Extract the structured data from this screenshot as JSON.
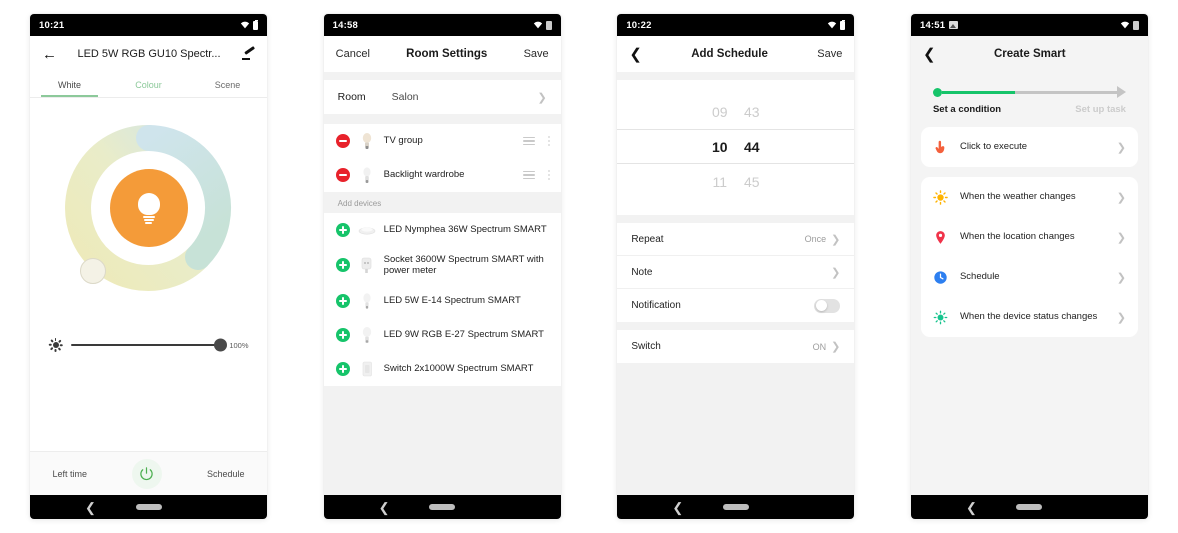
{
  "phone1": {
    "status": {
      "time": "10:21",
      "wifi": "wifi-icon",
      "battery": "battery-icon"
    },
    "appbar": {
      "back": "back-arrow-icon",
      "title": "LED 5W RGB GU10 Spectr...",
      "edit": "pencil-icon"
    },
    "tabs": [
      {
        "label": "White",
        "state": "active"
      },
      {
        "label": "Colour",
        "state": "green"
      },
      {
        "label": "Scene",
        "state": "normal"
      }
    ],
    "wheel": {
      "center_color": "#f49b39",
      "warm_color": "#eee7b5",
      "cool_color": "#cfe6ec",
      "mint_color": "#c9e3d8",
      "bulb_icon": "bulb-icon",
      "knob": "color-temperature-knob"
    },
    "slider": {
      "icon": "brightness-icon",
      "value_label": "100%"
    },
    "footer": {
      "left": "Left time",
      "power_icon": "power-icon",
      "right": "Schedule"
    },
    "nav": {
      "back": "nav-back-icon",
      "pill": "nav-home-pill"
    }
  },
  "phone2": {
    "status": {
      "time": "14:58"
    },
    "appbar": {
      "cancel": "Cancel",
      "title": "Room Settings",
      "save": "Save"
    },
    "room": {
      "key": "Room",
      "value": "Salon",
      "chevron": "chevron-right-icon"
    },
    "assigned": [
      {
        "name": "TV group",
        "action": "remove",
        "thumb": "light-device-thumb",
        "handle": "drag-handle-icon"
      },
      {
        "name": "Backlight wardrobe",
        "action": "remove",
        "thumb": "light-device-thumb",
        "handle": "drag-handle-icon"
      }
    ],
    "add_label": "Add devices",
    "available": [
      {
        "name": "LED Nymphea 36W Spectrum SMART",
        "thumb": "ceiling-lamp-thumb"
      },
      {
        "name": "Socket 3600W Spectrum SMART with power meter",
        "thumb": "socket-thumb"
      },
      {
        "name": "LED 5W E-14 Spectrum SMART",
        "thumb": "bulb-thumb"
      },
      {
        "name": "LED 9W RGB E-27 Spectrum SMART",
        "thumb": "bulb-thumb"
      },
      {
        "name": "Switch 2x1000W Spectrum SMART",
        "thumb": "switch-thumb"
      }
    ]
  },
  "phone3": {
    "status": {
      "time": "10:22"
    },
    "appbar": {
      "back": "back-chevron-icon",
      "title": "Add Schedule",
      "save": "Save"
    },
    "picker": {
      "prev": {
        "hour": "09",
        "minute": "43"
      },
      "selected": {
        "hour": "10",
        "minute": "44"
      },
      "next": {
        "hour": "11",
        "minute": "45"
      }
    },
    "options": [
      {
        "key": "Repeat",
        "value": "Once",
        "control": "chevron"
      },
      {
        "key": "Note",
        "value": "",
        "control": "chevron"
      },
      {
        "key": "Notification",
        "value": "",
        "control": "toggle-off"
      }
    ],
    "switch_row": {
      "key": "Switch",
      "value": "ON",
      "control": "chevron"
    }
  },
  "phone4": {
    "status": {
      "time": "14:51",
      "photo": "photo-icon"
    },
    "appbar": {
      "back": "back-chevron-icon",
      "title": "Create Smart"
    },
    "stepper": {
      "step1": "Set a condition",
      "step2": "Set up task",
      "active_color": "#16c46a",
      "inactive_color": "#c4c4c4"
    },
    "primary": {
      "label": "Click to execute",
      "icon": "tap-hand-icon",
      "icon_color": "#f4603c"
    },
    "conditions": [
      {
        "label": "When the weather changes",
        "icon": "sun-icon",
        "icon_color": "#ffb300"
      },
      {
        "label": "When the location changes",
        "icon": "location-pin-icon",
        "icon_color": "#f0334a"
      },
      {
        "label": "Schedule",
        "icon": "clock-icon",
        "icon_color": "#2d7ff0"
      },
      {
        "label": "When the device status changes",
        "icon": "device-status-icon",
        "icon_color": "#17c48e"
      }
    ]
  }
}
